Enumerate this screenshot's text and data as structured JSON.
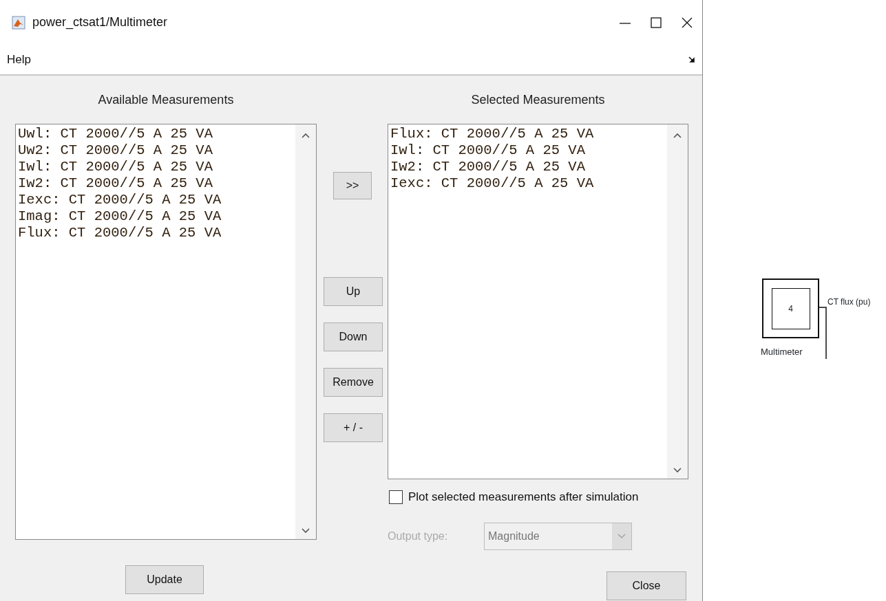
{
  "window": {
    "title": "power_ctsat1/Multimeter"
  },
  "menu": [
    "Help"
  ],
  "available": {
    "title": "Available Measurements",
    "items": [
      "Uwl: CT 2000//5 A 25 VA",
      "Uw2: CT 2000//5 A 25 VA",
      "Iwl: CT 2000//5 A 25 VA",
      "Iw2: CT 2000//5 A 25 VA",
      "Iexc: CT 2000//5 A 25 VA",
      "Imag: CT 2000//5 A 25 VA",
      "Flux: CT 2000//5 A 25 VA"
    ]
  },
  "add_button": ">>",
  "order_buttons": [
    "Up",
    "Down",
    "Remove",
    "+ / -"
  ],
  "selected": {
    "title": "Selected Measurements",
    "items": [
      "Flux: CT 2000//5 A 25 VA",
      "Iwl: CT 2000//5 A 25 VA",
      "Iw2: CT 2000//5 A 25 VA",
      "Iexc: CT 2000//5 A 25 VA"
    ]
  },
  "plot_checkbox": {
    "label": "Plot selected measurements after simulation",
    "checked": false
  },
  "output_type": {
    "label": "Output type:",
    "value": "Magnitude",
    "disabled": true
  },
  "update_button": "Update",
  "close_button": "Close",
  "canvas_block": {
    "value": "4",
    "name": "Multimeter",
    "signal_label": "CT flux (pu)"
  }
}
